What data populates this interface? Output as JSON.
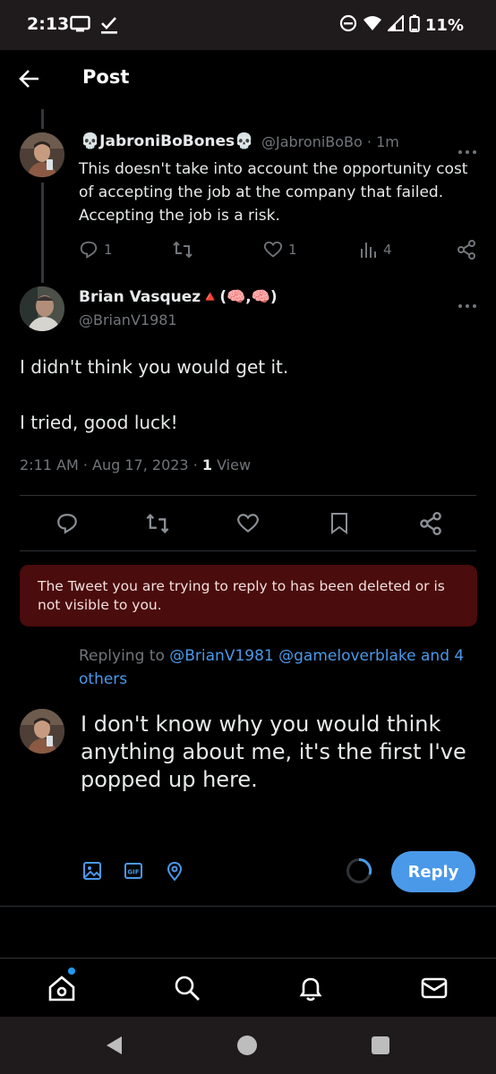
{
  "status_bar": {
    "time": "2:13",
    "battery": "11%"
  },
  "header": {
    "title": "Post"
  },
  "parent_tweet": {
    "display_name": "💀JabroniBoBones💀",
    "handle_time": "@JabroniBoBo · 1m",
    "text": "This doesn't take into account the opportunity cost of accepting the job at the company that failed. Accepting the job is a risk.",
    "replies": "1",
    "likes": "1",
    "views": "4"
  },
  "main_tweet": {
    "display_name": "Brian Vasquez🔺(🧠,🧠)",
    "handle": "@BrianV1981",
    "line1": "I didn't think you would get it.",
    "line2": "I tried, good luck!",
    "timestamp": "2:11 AM · Aug 17, 2023 · ",
    "view_count": "1",
    "view_label": " View"
  },
  "notice": {
    "text": "The Tweet you are trying to reply to has been deleted or is not visible to you."
  },
  "replying": {
    "prefix": "Replying to ",
    "targets": "@BrianV1981 @gameloverblake and 4 others"
  },
  "compose": {
    "text": "I don't know why you would think anything about me, it's the first I've popped up here.",
    "reply_label": "Reply"
  },
  "colors": {
    "accent": "#4a99e9",
    "notice_bg": "#4a0c0c",
    "muted": "#71767b"
  }
}
